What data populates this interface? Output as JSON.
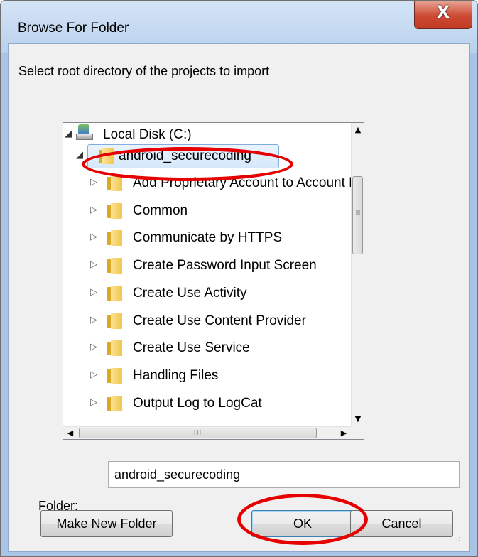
{
  "window": {
    "title": "Browse For Folder",
    "close_glyph": "X"
  },
  "dialog": {
    "instruction": "Select root directory of the projects to import"
  },
  "tree": {
    "root": {
      "label": "Local Disk (C:)",
      "icon": "drive-icon",
      "expanded": true
    },
    "selected": {
      "label": "android_securecoding",
      "icon": "folder-icon",
      "expanded": true
    },
    "children": [
      "Add Proprietary Account to Account Manag",
      "Common",
      "Communicate by HTTPS",
      "Create Password Input Screen",
      "Create Use Activity",
      "Create Use Content Provider",
      "Create Use Service",
      "Handling Files",
      "Output Log to LogCat"
    ],
    "scrollbar": {
      "vertical_grip": "≡",
      "horizontal_grip": "III"
    }
  },
  "folder_field": {
    "label": "Folder:",
    "value": "android_securecoding"
  },
  "buttons": {
    "make_new_folder": "Make New Folder",
    "ok": "OK",
    "cancel": "Cancel"
  },
  "colors": {
    "highlight_ring": "#e60000",
    "selection_fill": "#d5e8fb",
    "window_frame": "#a9c4e4"
  }
}
